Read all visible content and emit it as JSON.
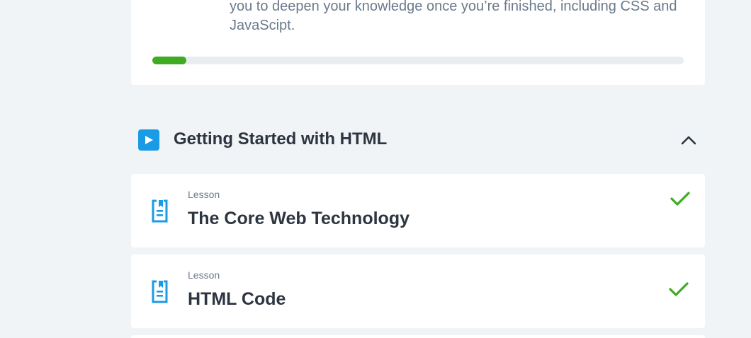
{
  "intro": {
    "text_line1": "you to deepen your knowledge once you’re finished, including CSS and",
    "text_line2": "JavaScipt.",
    "progress_percent": 6.4,
    "progress_color": "#3eab23"
  },
  "section": {
    "icon": "play-icon",
    "title": "Getting Started with HTML",
    "toggle_icon": "chevron-up-icon",
    "accent_color": "#1a9be6"
  },
  "lessons": [
    {
      "kind": "Lesson",
      "title": "The Core Web Technology",
      "icon": "document-icon",
      "status_icon": "check-icon",
      "completed": true
    },
    {
      "kind": "Lesson",
      "title": "HTML Code",
      "icon": "document-icon",
      "status_icon": "check-icon",
      "completed": true
    }
  ]
}
